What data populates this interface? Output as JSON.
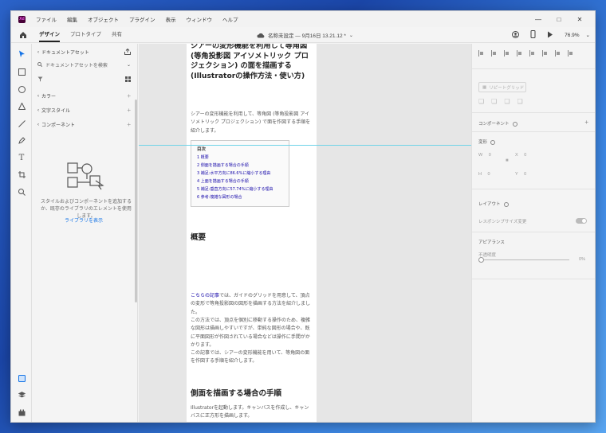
{
  "app": {
    "logo": "Xd",
    "menu": [
      "ファイル",
      "編集",
      "オブジェクト",
      "プラグイン",
      "表示",
      "ウィンドウ",
      "ヘルプ"
    ]
  },
  "toolbar": {
    "tabs": [
      "デザイン",
      "プロトタイプ",
      "共有"
    ],
    "doc_title": "名称未設定 — 9月16日 13.21.12 *",
    "zoom": "76.9%"
  },
  "assets": {
    "title": "ドキュメントアセット",
    "search_placeholder": "ドキュメントアセットを検索",
    "sections": [
      "カラー",
      "文字スタイル",
      "コンポーネント"
    ],
    "empty_text": "スタイルおよびコンポーネントを追加するか、既存のライブラリのエレメントを使用します。",
    "library_link": "ライブラリを表示"
  },
  "artboard": {
    "heading": "シアーの変形機能を利用して等角図 (等角投影図 アイソメトリック プロジェクション) の面を描画する (Illustratorの操作方法・使い方)",
    "intro": "シアーの変形機能を利用して、等角図 (等角投影図 アイソメトリック プロジェクション) で面を作図する手順を紹介します。",
    "toc_title": "目次",
    "toc_items": [
      "1 概要",
      "2 側面を描画する場合の手順",
      "3 補足:水平方向に86.6%に縮小する理由",
      "4 上面を描画する場合の手順",
      "5 補足:垂直方向に57.74%に縮小する理由",
      "6 参考:複雑な図形の場合"
    ],
    "section1_title": "概要",
    "section1_link": "こちらの記事",
    "section1_text": "では、ガイドのグリッドを用意して、頂点の変形で等角投影図の図形を描画する方法を紹介しました。",
    "section1_p2": "この方法では、頂点を個別に移動する操作のため、複雑な図形は描画しやすいですが、単純な図形の場合や、既に平面図形が作図されている場合などは操作に手間がかかります。",
    "section1_p3": "この記事では、シアーの変形機能を用いて、等角図の面を作図する手順を紹介します。",
    "section2_title": "側面を描画する場合の手順",
    "section2_text": "Illustratorを起動します。キャンバスを作成し、キャンバスに正方形を描画します。"
  },
  "props": {
    "repeat_grid": "リピートグリッド",
    "component": "コンポーネント",
    "transform": "変形",
    "w": "W",
    "h": "H",
    "x": "X",
    "y": "Y",
    "w_value": "0",
    "h_value": "0",
    "x_value": "0",
    "y_value": "0",
    "layout": "レイアウト",
    "responsive": "レスポンシブサイズ変更",
    "appearance": "アピアランス",
    "opacity_label": "不透明度",
    "opacity_value": "0%"
  }
}
